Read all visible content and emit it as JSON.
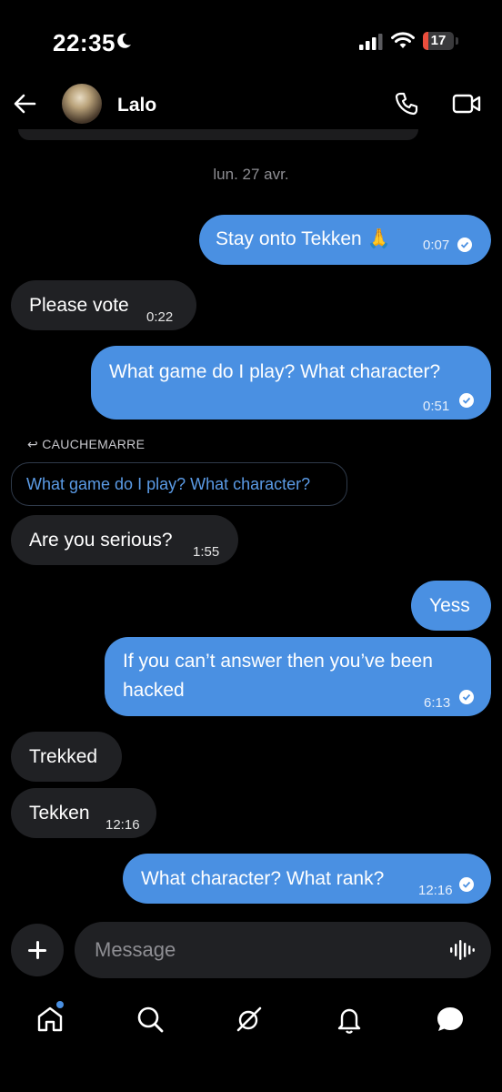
{
  "status_bar": {
    "time": "22:35",
    "battery": "17",
    "battery_level": 0.17,
    "battery_color": "#eb4e3d"
  },
  "header": {
    "name": "Lalo",
    "back_icon": "arrow-left-icon",
    "call_icon": "phone-icon",
    "video_icon": "video-icon"
  },
  "date_separator": "lun. 27 avr.",
  "messages": [
    {
      "dir": "out",
      "text": "Stay onto Tekken 🙏",
      "time": "0:07",
      "read": true
    },
    {
      "dir": "in",
      "text": "Please vote",
      "time": "0:22"
    },
    {
      "dir": "out",
      "text": "What game do I play? What character?",
      "time": "0:51",
      "read": true
    },
    {
      "dir": "in",
      "text": "Are you serious?",
      "time": "1:55"
    },
    {
      "dir": "out",
      "text": "Yess"
    },
    {
      "dir": "out",
      "text": "If you can’t answer then you’ve been hacked",
      "time": "6:13",
      "read": true
    },
    {
      "dir": "in",
      "text": "Trekked"
    },
    {
      "dir": "in",
      "text": "Tekken",
      "time": "12:16"
    },
    {
      "dir": "out",
      "text": "What character? What rank?",
      "time": "12:16",
      "read": true
    }
  ],
  "reply": {
    "label": "CAUCHEMARRE",
    "quote": "What game do I play? What character?"
  },
  "composer": {
    "placeholder": "Message"
  },
  "nav": {
    "items": [
      "home-icon",
      "search-icon",
      "grok-icon",
      "notifications-icon",
      "messages-icon"
    ]
  },
  "colors": {
    "accent": "#4a90e2",
    "incoming_bubble": "#202124",
    "background": "#000000"
  }
}
